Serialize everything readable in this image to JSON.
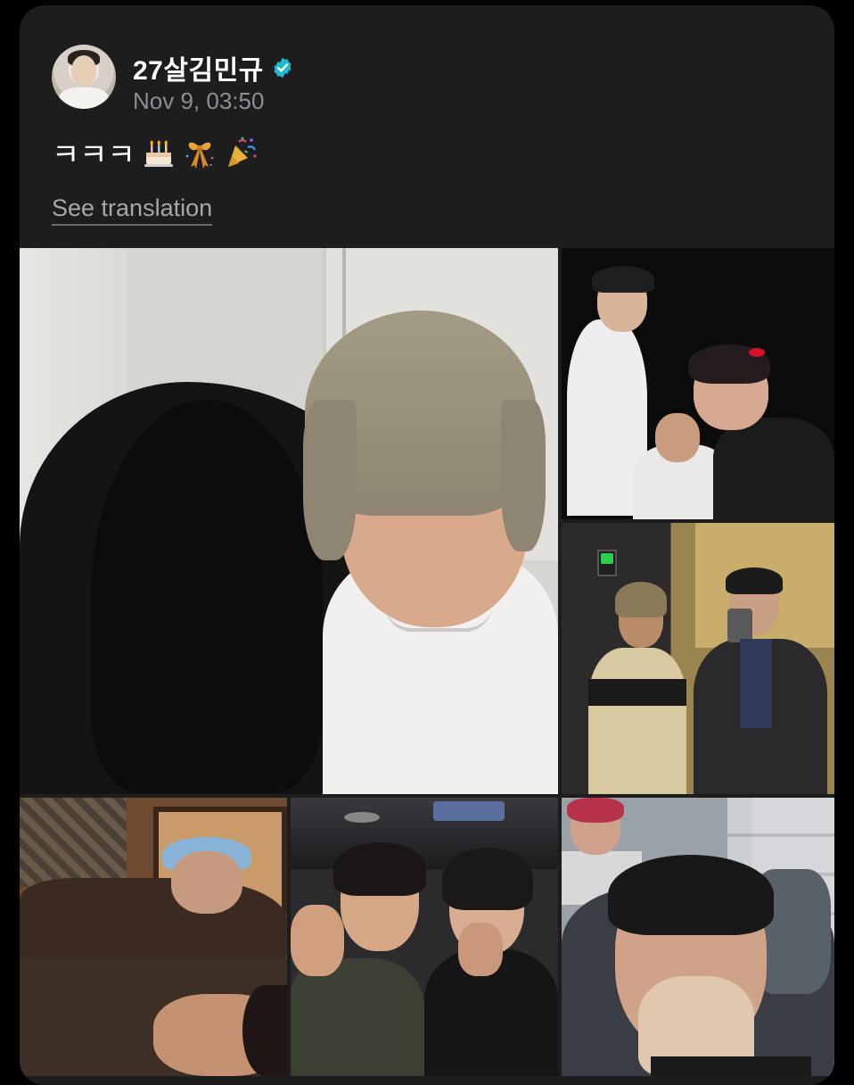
{
  "post": {
    "username": "27살김민규",
    "timestamp": "Nov 9, 03:50",
    "text": "ㅋㅋㅋ",
    "emojis": [
      "birthday-cake",
      "wrapped-ribbon",
      "party-popper"
    ],
    "see_translation": "See translation",
    "verified": true
  },
  "photos": [
    {
      "name": "photo-selfie-blonde-hair"
    },
    {
      "name": "photo-night-group"
    },
    {
      "name": "photo-street-mirror"
    },
    {
      "name": "photo-lying-bed"
    },
    {
      "name": "photo-bus-two"
    },
    {
      "name": "photo-train-mask"
    }
  ],
  "colors": {
    "card_bg": "#1d1d1e",
    "verified_badge": "#21b8d4",
    "secondary_text": "#8e8e93"
  }
}
